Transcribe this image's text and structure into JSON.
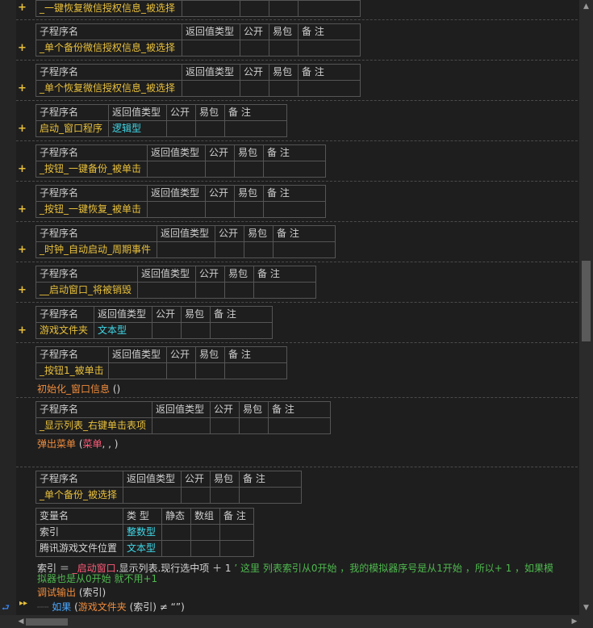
{
  "headers": {
    "sub": [
      "子程序名",
      "返回值类型",
      "公开",
      "易包",
      "备 注"
    ],
    "var": [
      "变量名",
      "类 型",
      "静态",
      "数组",
      "备 注"
    ]
  },
  "blocks": [
    {
      "name": "_一键恢复微信授权信息_被选择"
    },
    {
      "name": "_单个备份微信授权信息_被选择"
    },
    {
      "name": "_单个恢复微信授权信息_被选择"
    },
    {
      "name": "启动_窗口程序",
      "ret": "逻辑型"
    },
    {
      "name": "_按钮_一键备份_被单击"
    },
    {
      "name": "_按钮_一键恢复_被单击"
    },
    {
      "name": "_时钟_自动启动_周期事件"
    },
    {
      "name": "__启动窗口_将被销毁"
    },
    {
      "name": "游戏文件夹",
      "ret": "文本型"
    },
    {
      "name": "_按钮1_被单击"
    },
    {
      "name": "_显示列表_右键单击表项"
    },
    {
      "name": "_单个备份_被选择"
    }
  ],
  "code": {
    "init_call": "初始化_窗口信息",
    "init_args": " ()",
    "popup_call": "弹出菜单",
    "popup_open": " (",
    "popup_arg": "菜单",
    "popup_rest": ", , )",
    "vars": [
      {
        "name": "索引",
        "type": "整数型"
      },
      {
        "name": "腾讯游戏文件位置",
        "type": "文本型"
      }
    ],
    "assign_left": "索引 ＝ ",
    "assign_obj": "_启动窗口",
    "assign_mid": ".显示列表.现行选中项 ＋ 1",
    "comment1": "  ’ 这里 列表索引从0开始 ，我的模拟器序号是从1开始 ，所以+ 1 ，如果模",
    "comment2": "拟器也是从0开始  就不用+1",
    "debug_call": "调试输出",
    "debug_args": " (索引)",
    "if_kw": "如果",
    "if_open": " (",
    "if_fn": "游戏文件夹",
    "if_rest": " (索引) ≠ “”)"
  },
  "icons": {
    "expand": "plus-icon",
    "gutter": "breakpoint-arrow-icon",
    "run": "run-arrow-icon"
  }
}
